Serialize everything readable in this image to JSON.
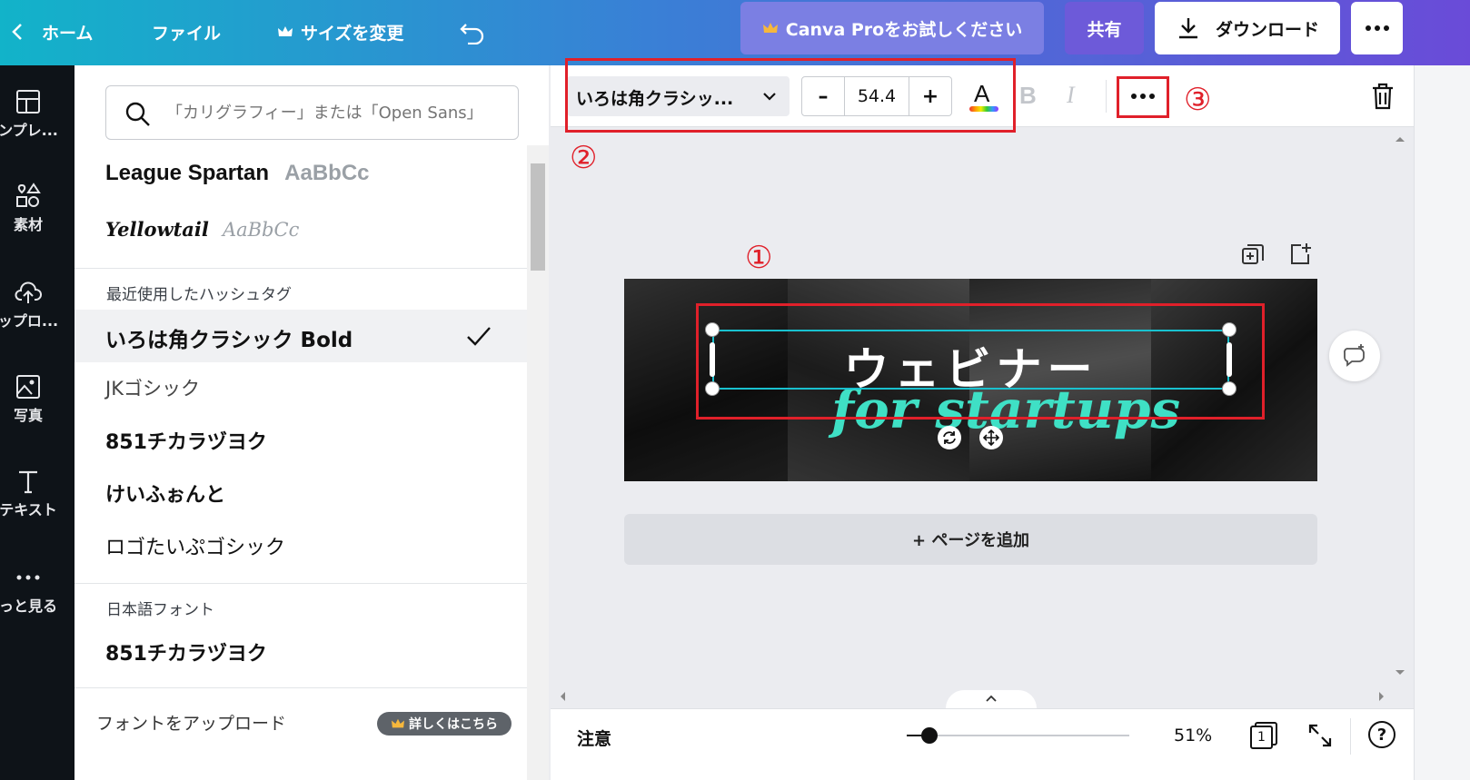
{
  "topbar": {
    "home_label": "ホーム",
    "file_label": "ファイル",
    "resize_label": "サイズを変更",
    "try_pro_label": "Canva Proをお試しください",
    "share_label": "共有",
    "download_label": "ダウンロード",
    "colors": {
      "pro_button": "#7a7fe0",
      "share_button": "#6b59d8"
    }
  },
  "rail": {
    "items": [
      {
        "label": "ンプレ...",
        "icon": "template-icon"
      },
      {
        "label": "素材",
        "icon": "elements-icon"
      },
      {
        "label": "ップロ...",
        "icon": "upload-icon"
      },
      {
        "label": "写真",
        "icon": "photo-icon"
      },
      {
        "label": "テキスト",
        "icon": "text-icon"
      },
      {
        "label": "っと見る",
        "icon": "more-icon"
      }
    ]
  },
  "font_panel": {
    "search_placeholder": "「カリグラフィー」または「Open Sans」",
    "featured": [
      {
        "name": "League Spartan",
        "sample": "AaBbCc"
      },
      {
        "name": "Yellowtail",
        "sample": "AaBbCc"
      }
    ],
    "recent_heading": "最近使用したハッシュタグ",
    "recent_fonts": [
      {
        "name": "いろは角クラシック Bold",
        "selected": true
      },
      {
        "name": "JKゴシック",
        "selected": false
      },
      {
        "name": "851チカラヅヨク",
        "selected": false
      },
      {
        "name": "けいふぉんと",
        "selected": false
      },
      {
        "name": "ロゴたいぷゴシック",
        "selected": false
      }
    ],
    "japanese_heading": "日本語フォント",
    "japanese_fonts": [
      {
        "name": "851チカラヅヨク"
      }
    ],
    "upload_label": "フォントをアップロード",
    "learn_more_label": "詳しくはこちら"
  },
  "toolbar": {
    "font_name": "いろは角クラシッ...",
    "font_size": "54.4",
    "minus": "–",
    "plus": "+",
    "color_letter": "A",
    "bold": "B",
    "italic": "I"
  },
  "canvas": {
    "title_text": "ウェビナー",
    "subtitle_text": "for startups",
    "add_page_label": "+ ページを追加",
    "accent_color": "#3fe0c5"
  },
  "annotations": {
    "one": "①",
    "two": "②",
    "three": "③",
    "color": "#e0202a"
  },
  "bottombar": {
    "notes_label": "注意",
    "zoom_label": "51%",
    "page_count": "1",
    "help_label": "?",
    "zoom_level": 0.2
  }
}
